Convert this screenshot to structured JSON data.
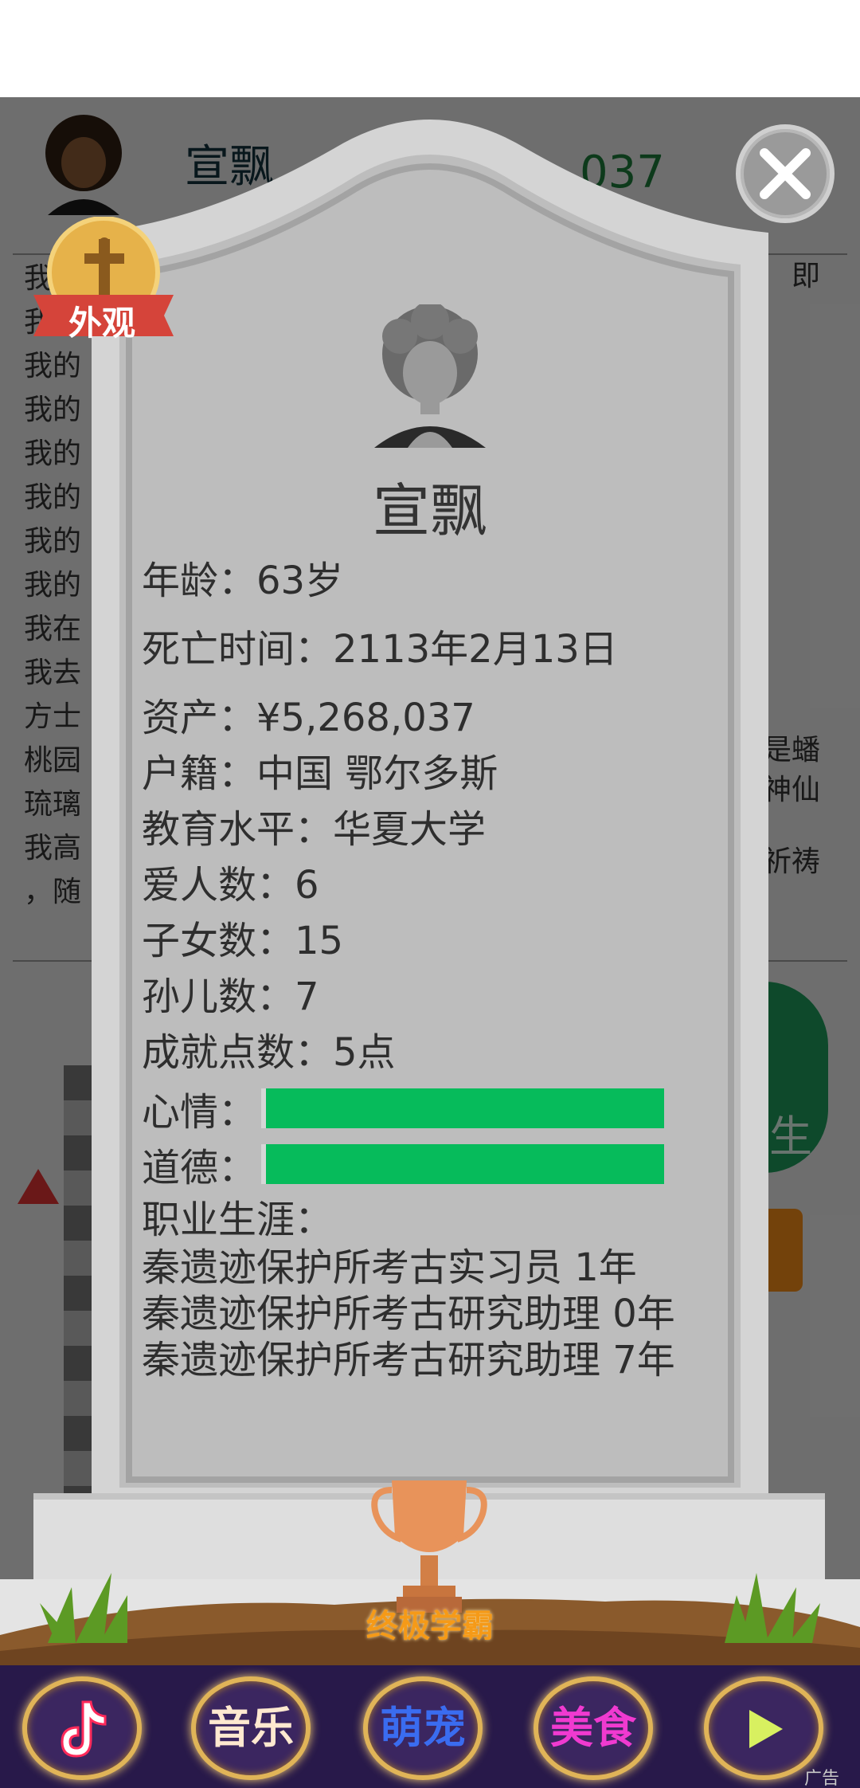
{
  "background": {
    "player_name": "宣飘",
    "money_partial": "037",
    "log_lines": [
      "我",
      "我的",
      "我的",
      "我的",
      "我的",
      "我的",
      "我的",
      "我的",
      "我在",
      "我去",
      "方士",
      "桃园",
      "琉璃",
      "我高",
      "，随"
    ],
    "log_right_fragments": [
      "即",
      "是蟠",
      "神仙",
      "祈祷"
    ],
    "green_button_text": "生"
  },
  "tombstone": {
    "name": "宣飘",
    "fields": [
      {
        "label": "年龄：",
        "value": "63岁"
      },
      {
        "label": "死亡时间：",
        "value": "2113年2月13日"
      },
      {
        "label": "资产：",
        "value": "¥5,268,037"
      },
      {
        "label": "户籍：",
        "value": "中国 鄂尔多斯"
      },
      {
        "label": "教育水平：",
        "value": "华夏大学"
      },
      {
        "label": "爱人数：",
        "value": "6"
      },
      {
        "label": "子女数：",
        "value": "15"
      },
      {
        "label": "孙儿数：",
        "value": "7"
      },
      {
        "label": "成就点数：",
        "value": "5点"
      }
    ],
    "bars": [
      {
        "label": "心情：",
        "level": 1.0,
        "color": "#06bb5b"
      },
      {
        "label": "道德：",
        "level": 1.0,
        "color": "#06bb5b"
      }
    ],
    "career_title": "职业生涯：",
    "career": [
      "秦遗迹保护所考古实习员 1年",
      "秦遗迹保护所考古研究助理 0年",
      "秦遗迹保护所考古研究助理 7年"
    ]
  },
  "badge": {
    "label": "外观",
    "icon": "cross-icon"
  },
  "close_icon": "close-icon",
  "achievement": {
    "title": "终极学霸",
    "icon": "trophy-icon"
  },
  "ad_bar": {
    "items": [
      {
        "label": "",
        "icon": "tiktok-icon",
        "color": "#ffffff"
      },
      {
        "label": "音乐",
        "color": "#ffe9d0"
      },
      {
        "label": "萌宠",
        "color": "#3a6cf0"
      },
      {
        "label": "美食",
        "color": "#f03ad0"
      },
      {
        "label": "",
        "icon": "play-icon",
        "color": "#d8f060"
      }
    ],
    "ad_tag": "广告"
  }
}
